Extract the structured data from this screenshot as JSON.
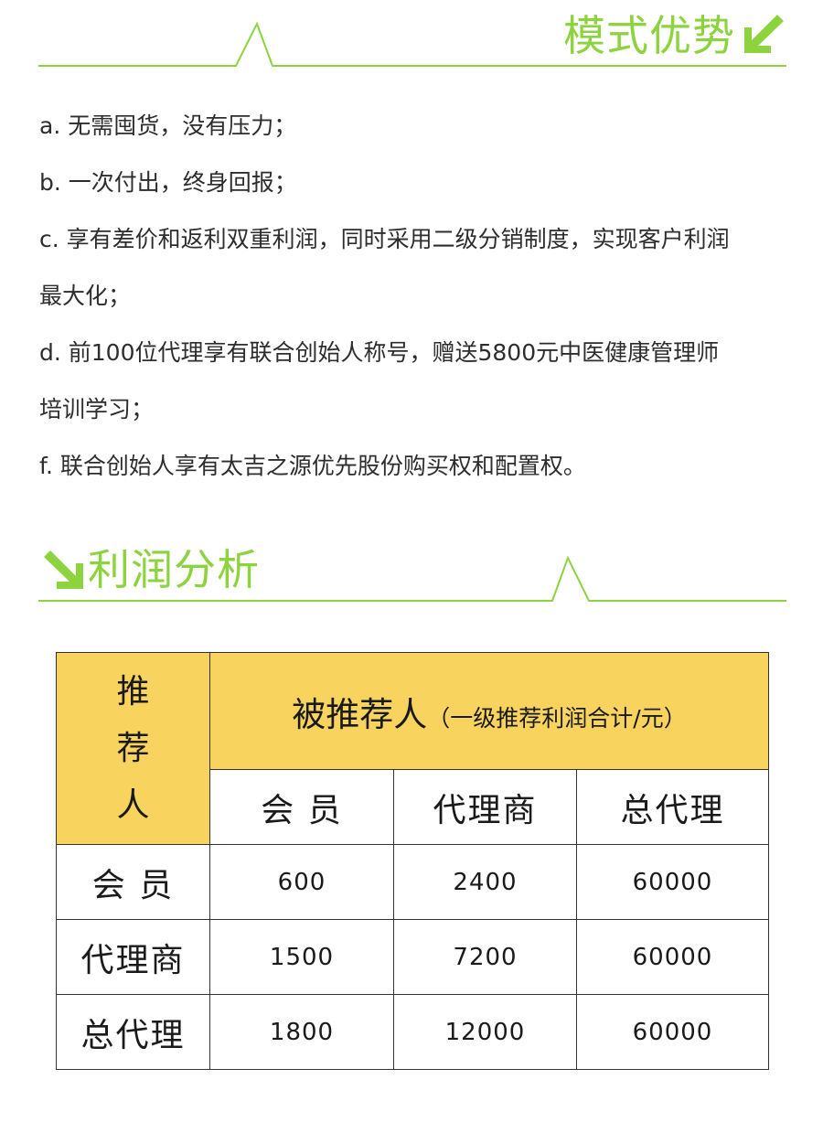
{
  "advantages": {
    "title": "模式优势",
    "lines": [
      "a. 无需囤货，没有压力；",
      "b. 一次付出，终身回报；",
      "c. 享有差价和返利双重利润，同时采用二级分销制度，实现客户利润",
      "最大化；",
      "d. 前100位代理享有联合创始人称号，赠送5800元中医健康管理师",
      "培训学习；",
      "f. 联合创始人享有太吉之源优先股份购买权和配置权。"
    ]
  },
  "profit": {
    "title": "利润分析",
    "table": {
      "corner_chars": [
        "推",
        "荐",
        "人"
      ],
      "header_main": "被推荐人",
      "header_sub": "（一级推荐利润合计/元）",
      "columns": [
        "会 员",
        "代理商",
        "总代理"
      ],
      "rows": [
        {
          "label": "会 员",
          "values": [
            "600",
            "2400",
            "60000"
          ]
        },
        {
          "label": "代理商",
          "values": [
            "1500",
            "7200",
            "60000"
          ]
        },
        {
          "label": "总代理",
          "values": [
            "1800",
            "12000",
            "60000"
          ]
        }
      ]
    }
  },
  "colors": {
    "accent": "#8cd33e",
    "table_highlight": "#f8d35e"
  }
}
